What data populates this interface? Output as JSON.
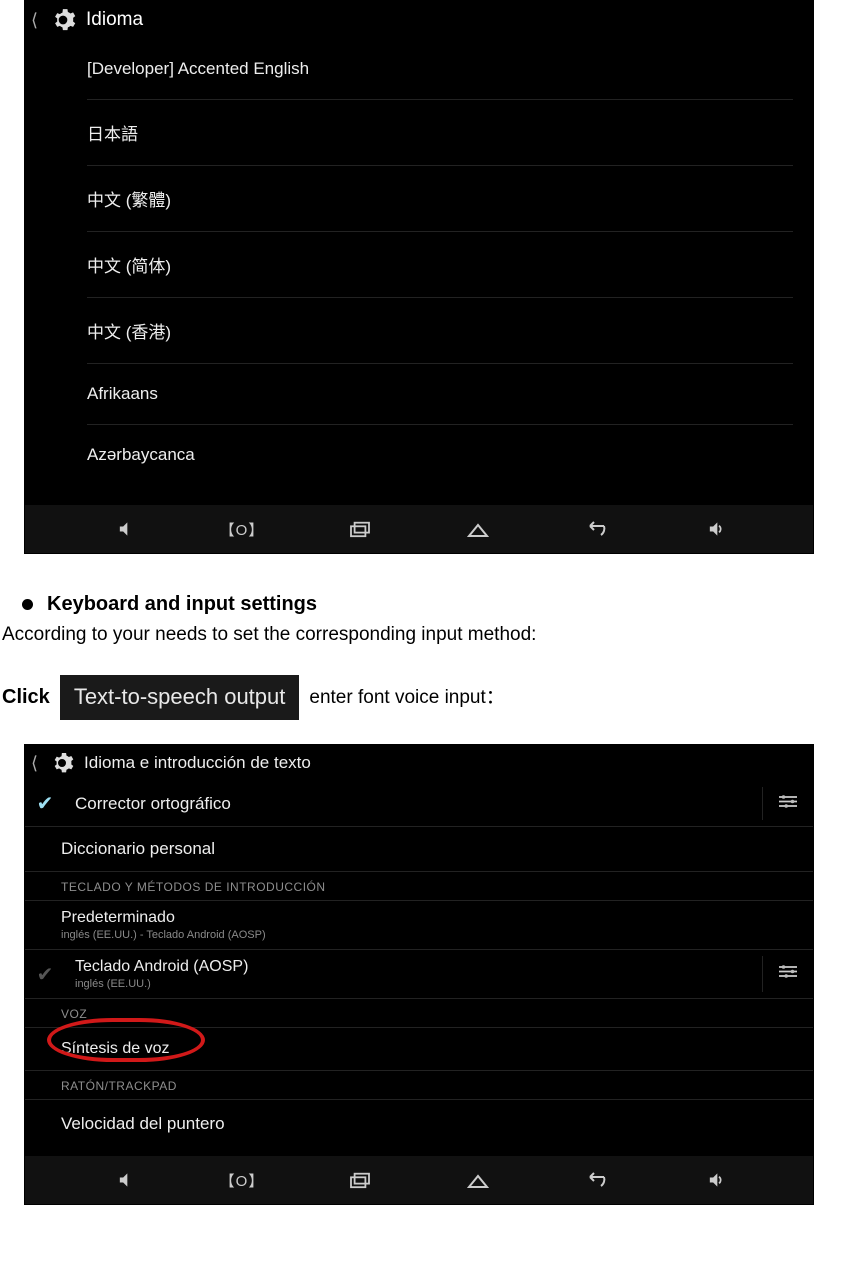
{
  "screenshot1": {
    "header_title": "Idioma",
    "languages": [
      "[Developer] Accented English",
      "日本語",
      "中文 (繁體)",
      "中文 (简体)",
      "中文 (香港)",
      "Afrikaans",
      "Azərbaycanca"
    ]
  },
  "doc": {
    "bullet_title": "Keyboard and input settings",
    "body_line": "According to your needs to set the corresponding input method:",
    "click_label": "Click",
    "tts_chip": "Text-to-speech output",
    "after_chip": " enter font voice input："
  },
  "screenshot2": {
    "header_title": "Idioma e introducción de texto",
    "corrector": {
      "title": "Corrector ortográfico"
    },
    "diccionario": {
      "title": "Diccionario personal"
    },
    "section_keyboard": "TECLADO Y MÉTODOS DE INTRODUCCIÓN",
    "predeterminado": {
      "title": "Predeterminado",
      "sub": "inglés (EE.UU.) - Teclado Android (AOSP)"
    },
    "teclado": {
      "title": "Teclado Android (AOSP)",
      "sub": "inglés (EE.UU.)"
    },
    "section_voice": "VOZ",
    "sintesis": {
      "title": "Síntesis de voz"
    },
    "section_mouse": "RATÓN/TRACKPAD",
    "velocidad": {
      "title": "Velocidad del puntero"
    }
  }
}
